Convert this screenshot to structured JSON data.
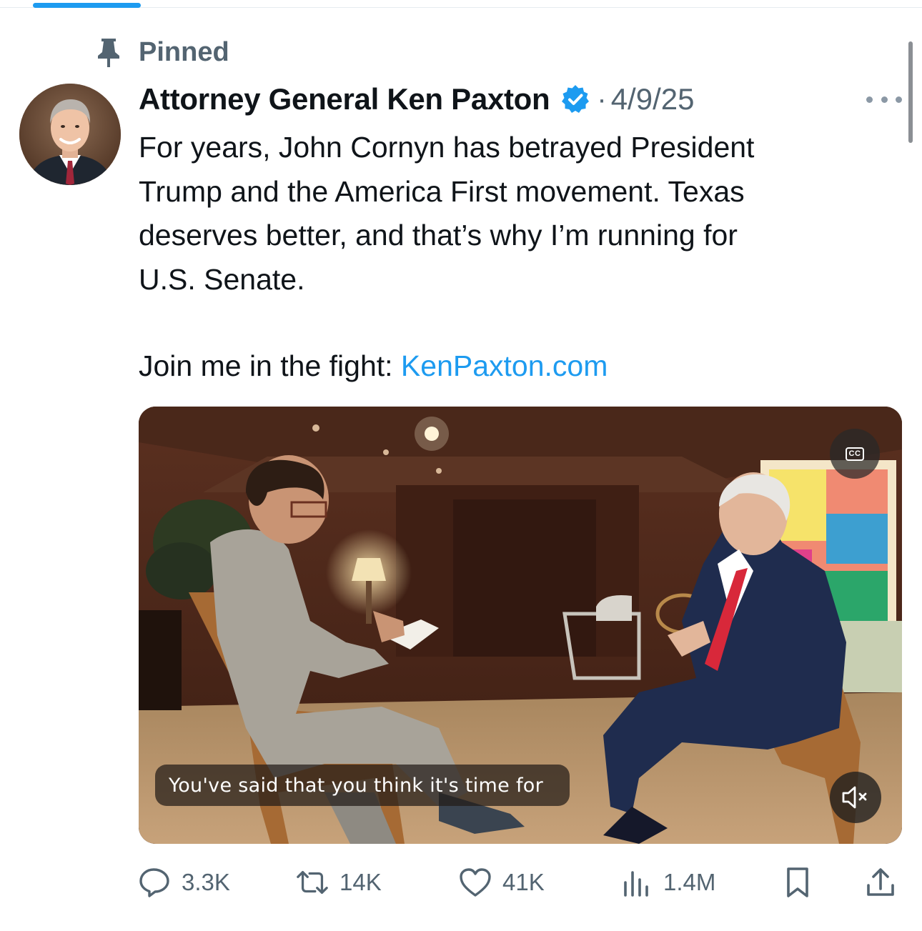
{
  "pinned": {
    "label": "Pinned"
  },
  "post": {
    "author": "Attorney General Ken Paxton",
    "date": "4/9/25",
    "separator": "·",
    "text_lines": [
      "For years, John Cornyn has betrayed President",
      "Trump and the America First movement. Texas",
      "deserves better, and that’s why I’m running for",
      "U.S. Senate."
    ],
    "join_text": "Join me in the fight: ",
    "link_text": "KenPaxton.com"
  },
  "media": {
    "cc_label": "CC",
    "caption": "You've said that you think it's time for"
  },
  "actions": {
    "replies": "3.3K",
    "reposts": "14K",
    "likes": "41K",
    "views": "1.4M"
  },
  "colors": {
    "accent": "#1d9bf0",
    "secondary_text": "#536471",
    "primary_text": "#0f1419"
  },
  "icons": [
    "pin-icon",
    "verified-badge-icon",
    "more-icon",
    "closed-captions-icon",
    "mute-icon",
    "reply-icon",
    "repost-icon",
    "like-icon",
    "views-icon",
    "bookmark-icon",
    "share-icon"
  ]
}
